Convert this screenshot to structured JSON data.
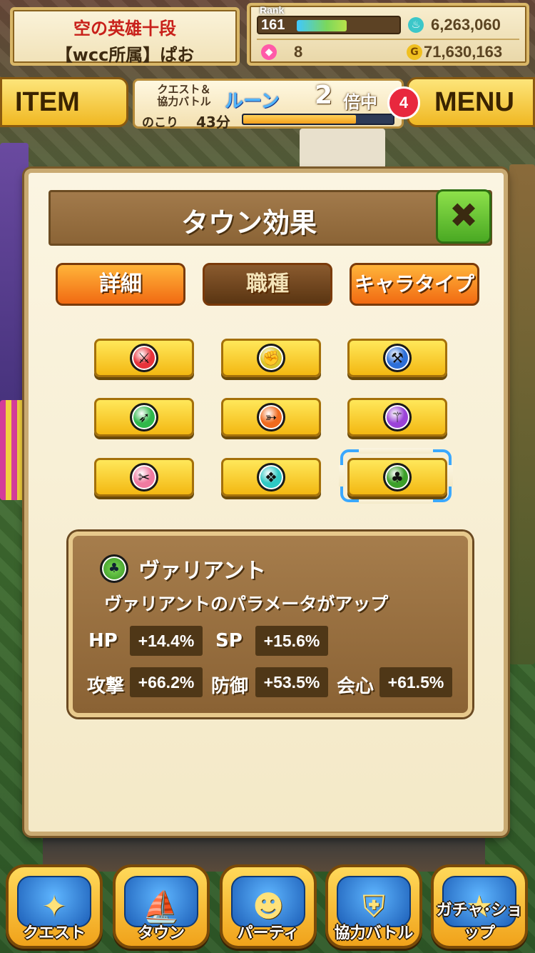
{
  "header": {
    "title_line1": "空の英雄十段",
    "title_line2": "【wcc所属】ぱお",
    "rank_label": "Rank",
    "rank": "161",
    "rank_progress": 0.5,
    "stamina": "6,263,060",
    "gems": "8",
    "gold": "71,630,163"
  },
  "top_bar": {
    "item_label": "ITEM",
    "menu_label": "MENU",
    "menu_badge": "4",
    "event_small": "クエスト＆\n協力バトル",
    "event_rune": "ルーン",
    "event_multiplier": "2",
    "event_multiplier_suffix": "倍中",
    "remaining_label": "のこり",
    "remaining_time": "43分",
    "remaining_progress": 0.75
  },
  "panel": {
    "title": "タウン効果",
    "tabs": [
      {
        "label": "詳細",
        "style": "orange"
      },
      {
        "label": "職種",
        "style": "brown"
      },
      {
        "label": "キャラタイプ",
        "style": "orange"
      }
    ],
    "jobs": [
      {
        "icon": "sword-icon",
        "glyph": "⚔",
        "color": "#e8323a"
      },
      {
        "icon": "fist-icon",
        "glyph": "✊",
        "color": "#d9c52a"
      },
      {
        "icon": "axe-icon",
        "glyph": "⚒",
        "color": "#2d6fd8"
      },
      {
        "icon": "spear-icon",
        "glyph": "➶",
        "color": "#2fb84a"
      },
      {
        "icon": "bow-icon",
        "glyph": "➳",
        "color": "#f16a1e"
      },
      {
        "icon": "staff-icon",
        "glyph": "⚚",
        "color": "#9b43d8"
      },
      {
        "icon": "dagger-icon",
        "glyph": "✂",
        "color": "#f07aa0"
      },
      {
        "icon": "dragon-icon",
        "glyph": "❖",
        "color": "#2fc9c4"
      },
      {
        "icon": "variant-icon",
        "glyph": "♣",
        "color": "#3ca02a"
      }
    ],
    "selected_index": 8
  },
  "info": {
    "name": "ヴァリアント",
    "description": "ヴァリアントのパラメータがアップ",
    "stats": [
      {
        "label": "HP",
        "value": "+14.4%"
      },
      {
        "label": "SP",
        "value": "+15.6%"
      },
      {
        "label": "攻撃",
        "value": "+66.2%"
      },
      {
        "label": "防御",
        "value": "+53.5%"
      },
      {
        "label": "会心",
        "value": "+61.5%"
      }
    ]
  },
  "nav": [
    {
      "label": "クエスト",
      "icon": "quest-map-icon",
      "glyph": "✦"
    },
    {
      "label": "タウン",
      "icon": "town-ship-icon",
      "glyph": "⛵"
    },
    {
      "label": "パーティ",
      "icon": "party-icon",
      "glyph": "☻"
    },
    {
      "label": "協力バトル",
      "icon": "shield-icon",
      "glyph": "⛨"
    },
    {
      "label": "ガチャ･ショップ",
      "icon": "star-icon",
      "glyph": "★"
    }
  ]
}
